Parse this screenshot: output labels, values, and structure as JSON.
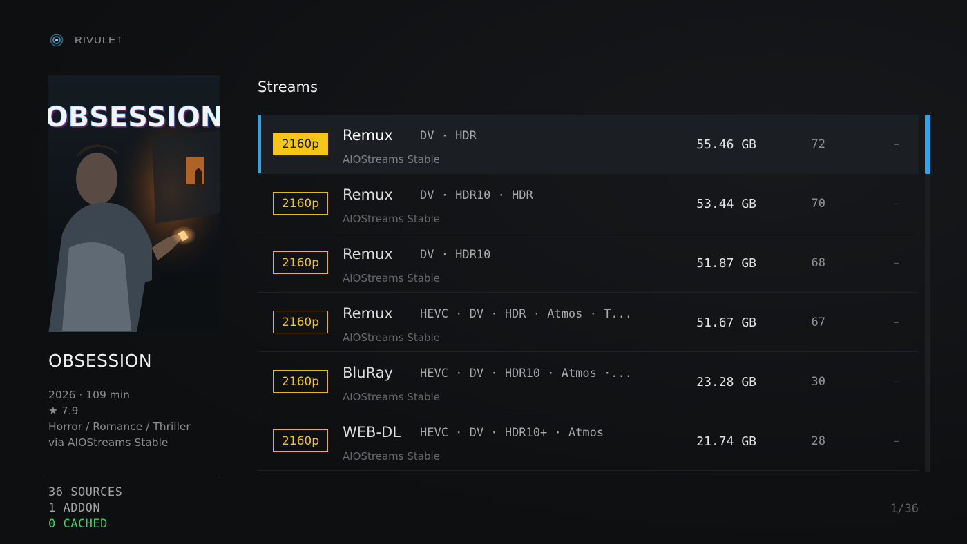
{
  "app": {
    "brand_name": "RIVULET",
    "accent_color": "#2fa4e7",
    "badge_color": "#f5c518",
    "cached_color": "#3ccf6a"
  },
  "movie": {
    "poster_title": "OBSESSION",
    "title": "OBSESSION",
    "year_runtime": "2026 · 109 min",
    "rating": "★ 7.9",
    "genres": "Horror / Romance / Thriller",
    "via": "via AIOStreams Stable"
  },
  "stats": {
    "sources": "36 SOURCES",
    "addons": "1 ADDON",
    "cached": "0 CACHED"
  },
  "streams": {
    "heading": "Streams",
    "pager": "1/36",
    "scroll_fraction_visible": 0.167,
    "items": [
      {
        "resolution": "2160p",
        "quality": "Remux",
        "tags": "DV · HDR",
        "provider": "AIOStreams Stable",
        "size": "55.46 GB",
        "seeds": "72",
        "status": "–",
        "selected": true
      },
      {
        "resolution": "2160p",
        "quality": "Remux",
        "tags": "DV · HDR10 · HDR",
        "provider": "AIOStreams Stable",
        "size": "53.44 GB",
        "seeds": "70",
        "status": "–",
        "selected": false
      },
      {
        "resolution": "2160p",
        "quality": "Remux",
        "tags": "DV · HDR10",
        "provider": "AIOStreams Stable",
        "size": "51.87 GB",
        "seeds": "68",
        "status": "–",
        "selected": false
      },
      {
        "resolution": "2160p",
        "quality": "Remux",
        "tags": "HEVC · DV · HDR · Atmos · T...",
        "provider": "AIOStreams Stable",
        "size": "51.67 GB",
        "seeds": "67",
        "status": "–",
        "selected": false
      },
      {
        "resolution": "2160p",
        "quality": "BluRay",
        "tags": "HEVC · DV · HDR10 · Atmos ·...",
        "provider": "AIOStreams Stable",
        "size": "23.28 GB",
        "seeds": "30",
        "status": "–",
        "selected": false
      },
      {
        "resolution": "2160p",
        "quality": "WEB-DL",
        "tags": "HEVC · DV · HDR10+ · Atmos",
        "provider": "AIOStreams Stable",
        "size": "21.74 GB",
        "seeds": "28",
        "status": "–",
        "selected": false
      }
    ]
  }
}
